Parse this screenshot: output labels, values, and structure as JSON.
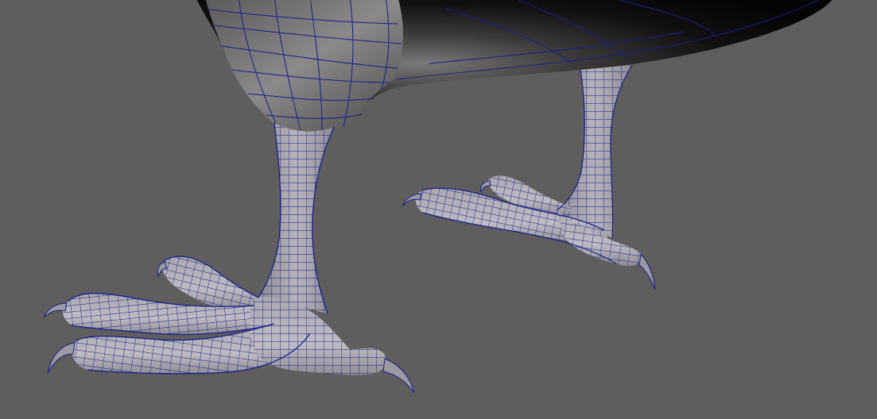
{
  "viewport": {
    "background_color": "#5e5e5e",
    "wireframe_color": "#1c1c8c",
    "mesh_fill_color": "#9c9ca2",
    "body_shadow_color": "#050505"
  },
  "scene": {
    "subject": "bird-legs-wireframe-on-shaded",
    "legs": [
      "front-leg",
      "back-leg"
    ]
  }
}
